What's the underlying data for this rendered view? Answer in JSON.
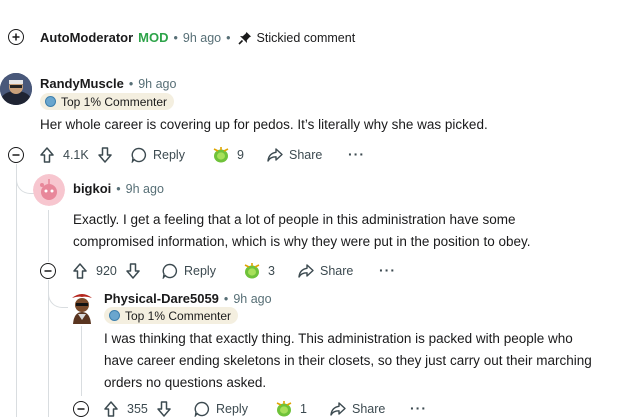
{
  "automod": {
    "username": "AutoModerator",
    "role": "MOD",
    "time": "9h ago",
    "stickied": "Stickied comment"
  },
  "comments": [
    {
      "username": "RandyMuscle",
      "time": "9h ago",
      "flair": "Top 1% Commenter",
      "body": [
        "Her whole career is covering up for pedos. It’s literally why she was picked."
      ],
      "votes": "4.1K",
      "reply": "Reply",
      "award_count": "9",
      "share": "Share"
    },
    {
      "username": "bigkoi",
      "time": "9h ago",
      "body": [
        "Exactly. I get a feeling that a lot of people in this administration have some",
        "compromised information, which is why they were put in the position to obey."
      ],
      "votes": "920",
      "reply": "Reply",
      "award_count": "3",
      "share": "Share"
    },
    {
      "username": "Physical-Dare5059",
      "time": "9h ago",
      "flair": "Top 1% Commenter",
      "body": [
        "I was thinking that exactly thing. This administration is packed with people who",
        "have career ending skeletons in their closets, so they just carry out their marching",
        "orders no questions asked."
      ],
      "votes": "355",
      "reply": "Reply",
      "award_count": "1",
      "share": "Share"
    }
  ],
  "separator": "•",
  "more": "···",
  "colors": {
    "mod_green": "#2da349",
    "meta_gray": "#576f76",
    "flair_bg": "#f4efe0",
    "thread_line": "#d9dde0"
  }
}
